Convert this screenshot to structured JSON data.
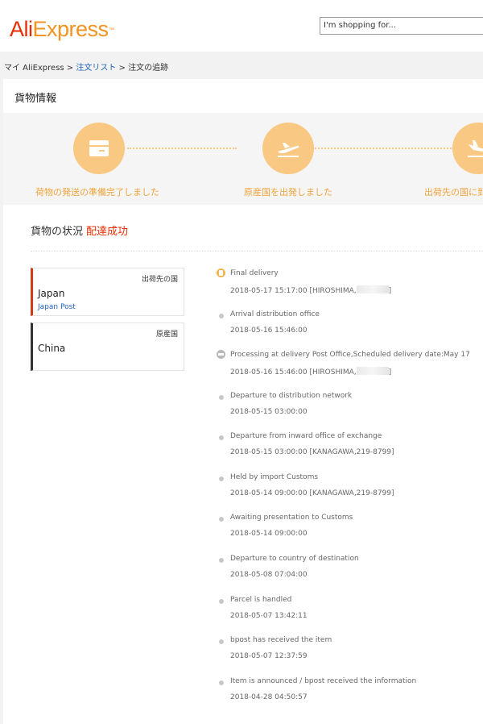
{
  "header": {
    "logo_ali": "Ali",
    "logo_express": "Express",
    "logo_tm": "™",
    "search_placeholder": "I'm shopping for..."
  },
  "breadcrumb": {
    "home": "マイ AliExpress",
    "sep1": " > ",
    "orders": "注文リスト",
    "sep2": " > ",
    "current": "注文の追跡"
  },
  "panel": {
    "title": "貨物情報"
  },
  "steps": [
    {
      "label": "荷物の発送の準備完了しました",
      "icon": "package-icon"
    },
    {
      "label": "原産国を出発しました",
      "icon": "plane-departure-icon"
    },
    {
      "label": "出荷先の国に到",
      "icon": "plane-arrival-icon"
    }
  ],
  "status": {
    "label": "貨物の状況",
    "value": "配達成功"
  },
  "cards": {
    "destination": {
      "tag": "出荷先の国",
      "country": "Japan",
      "carrier": "Japan Post"
    },
    "origin": {
      "tag": "原産国",
      "country": "China"
    }
  },
  "events": [
    {
      "title": "Final delivery",
      "time": "2018-05-17 15:17:00",
      "location": "[HIROSHIMA,",
      "end": "]"
    },
    {
      "title": "Arrival distribution office",
      "time": "2018-05-16 15:46:00"
    },
    {
      "title": "Processing at delivery Post Office,Scheduled delivery date:May 17",
      "time": "2018-05-16 15:46:00",
      "location": "[HIROSHIMA,",
      "end": "]"
    },
    {
      "title": "Departure to distribution network",
      "time": "2018-05-15 03:00:00"
    },
    {
      "title": "Departure from inward office of exchange",
      "time": "2018-05-15 03:00:00",
      "location": "[KANAGAWA,219-8799]"
    },
    {
      "title": "Held by import Customs",
      "time": "2018-05-14 09:00:00",
      "location": "[KANAGAWA,219-8799]"
    },
    {
      "title": "Awaiting presentation to Customs",
      "time": "2018-05-14 09:00:00"
    },
    {
      "title": "Departure to country of destination",
      "time": "2018-05-08 07:04:00"
    },
    {
      "title": "Parcel is handled",
      "time": "2018-05-07 13:42:11"
    },
    {
      "title": "bpost has received the item",
      "time": "2018-05-07 12:37:59"
    },
    {
      "title": "Item is announced / bpost received the information",
      "time": "2018-04-28 04:50:57"
    }
  ],
  "colors": {
    "brand_red": "#e62e04",
    "brand_orange": "#f29322",
    "step_circle": "#f9c983",
    "step_label": "#f0a33a",
    "link_blue": "#2161b4"
  }
}
